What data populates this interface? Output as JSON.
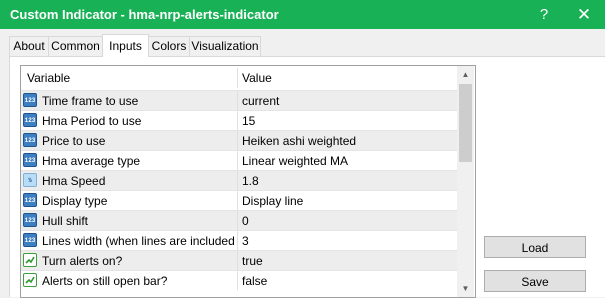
{
  "window": {
    "title": "Custom Indicator - hma-nrp-alerts-indicator",
    "help_glyph": "?",
    "close_glyph": "✕",
    "accent": "#18b156"
  },
  "tabs": [
    {
      "label": "About",
      "active": false
    },
    {
      "label": "Common",
      "active": false
    },
    {
      "label": "Inputs",
      "active": true
    },
    {
      "label": "Colors",
      "active": false
    },
    {
      "label": "Visualization",
      "active": false
    }
  ],
  "table": {
    "columns": {
      "variable": "Variable",
      "value": "Value"
    },
    "rows": [
      {
        "icon": "integer-icon",
        "type": "num",
        "badge": "123",
        "variable": "Time frame to use",
        "value": "current"
      },
      {
        "icon": "integer-icon",
        "type": "num",
        "badge": "123",
        "variable": "Hma Period to use",
        "value": "15"
      },
      {
        "icon": "integer-icon",
        "type": "num",
        "badge": "123",
        "variable": "Price to use",
        "value": "Heiken ashi weighted"
      },
      {
        "icon": "integer-icon",
        "type": "num",
        "badge": "123",
        "variable": "Hma average type",
        "value": "Linear weighted MA"
      },
      {
        "icon": "double-icon",
        "type": "frac",
        "badge": "½",
        "variable": "Hma Speed",
        "value": "1.8"
      },
      {
        "icon": "integer-icon",
        "type": "num",
        "badge": "123",
        "variable": "Display type",
        "value": "Display line"
      },
      {
        "icon": "integer-icon",
        "type": "num",
        "badge": "123",
        "variable": "Hull shift",
        "value": "0"
      },
      {
        "icon": "integer-icon",
        "type": "num",
        "badge": "123",
        "variable": "Lines width (when lines are included in ...",
        "value": "3"
      },
      {
        "icon": "boolean-icon",
        "type": "bool",
        "badge": "",
        "variable": "Turn alerts on?",
        "value": "true"
      },
      {
        "icon": "boolean-icon",
        "type": "bool",
        "badge": "",
        "variable": "Alerts on still open bar?",
        "value": "false"
      }
    ]
  },
  "buttons": {
    "load": "Load",
    "save": "Save"
  }
}
